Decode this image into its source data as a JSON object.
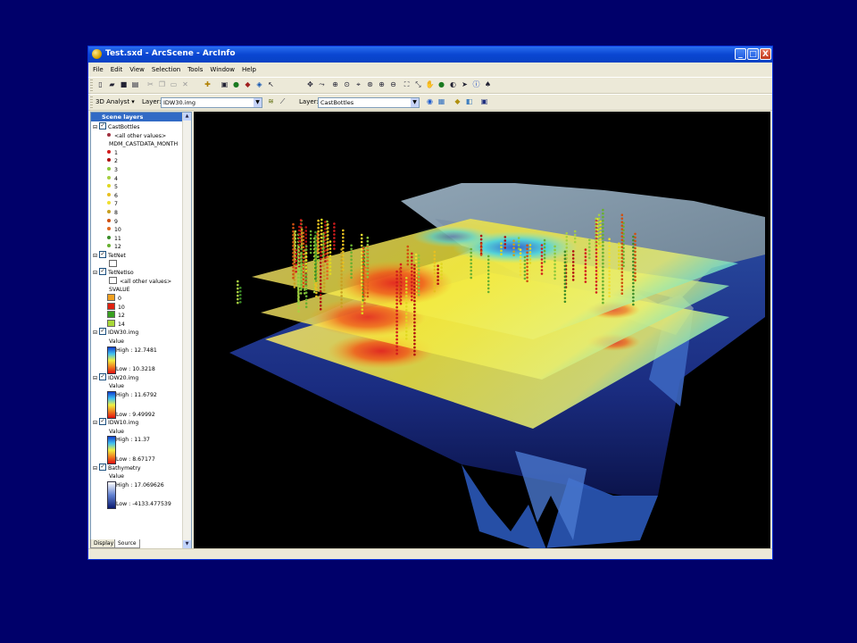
{
  "window": {
    "title": "Test.sxd - ArcScene - ArcInfo",
    "buttons": [
      "_",
      "□",
      "X"
    ]
  },
  "menu": [
    "File",
    "Edit",
    "View",
    "Selection",
    "Tools",
    "Window",
    "Help"
  ],
  "toolbar": {
    "analyst_label": "3D Analyst ▾",
    "layer_label_1": "Layer:",
    "layer_value_1": "IDW30.img",
    "layer_label_2": "Layer:",
    "layer_value_2": "CastBottles"
  },
  "toc": {
    "header": "Scene layers",
    "layers": [
      {
        "name": "CastBottles",
        "checked": true
      },
      {
        "name": "TetNet",
        "checked": true
      },
      {
        "name": "TetNetIso",
        "checked": true
      },
      {
        "name": "IDW30.img",
        "checked": true
      },
      {
        "name": "IDW20.img",
        "checked": true
      },
      {
        "name": "IDW10.img",
        "checked": true
      },
      {
        "name": "Bathymetry",
        "checked": true
      }
    ],
    "cast": {
      "other": "<all other values>",
      "field": "MDM_CASTDATA_MONTH",
      "values": [
        {
          "label": "1",
          "color": "#d21c1c"
        },
        {
          "label": "2",
          "color": "#b01010"
        },
        {
          "label": "3",
          "color": "#8cc83c"
        },
        {
          "label": "4",
          "color": "#a8d040"
        },
        {
          "label": "5",
          "color": "#e0d820"
        },
        {
          "label": "6",
          "color": "#e8c020"
        },
        {
          "label": "7",
          "color": "#f0e030"
        },
        {
          "label": "8",
          "color": "#c8a020"
        },
        {
          "label": "9",
          "color": "#d05010"
        },
        {
          "label": "10",
          "color": "#e06820"
        },
        {
          "label": "11",
          "color": "#3c8c28"
        },
        {
          "label": "12",
          "color": "#68b030"
        }
      ]
    },
    "iso": {
      "other": "<all other values>",
      "field": "SVALUE",
      "values": [
        {
          "label": "0",
          "color": "#f0a020"
        },
        {
          "label": "10",
          "color": "#e02010"
        },
        {
          "label": "12",
          "color": "#38a020"
        },
        {
          "label": "14",
          "color": "#a8d838"
        }
      ]
    },
    "idw30": {
      "value": "Value",
      "high": "High : 12.7481",
      "low": "Low : 10.3218"
    },
    "idw20": {
      "value": "Value",
      "high": "High : 11.6792",
      "low": "Low : 9.49992"
    },
    "idw10": {
      "value": "Value",
      "high": "High : 11.37",
      "low": "Low : 8.67177"
    },
    "bathy": {
      "value": "Value",
      "high": "High : 17.069626",
      "low": "Low : -4133.477539"
    },
    "tabs": [
      "Display",
      "Source"
    ]
  },
  "colors": {
    "background": "#00006a",
    "ramp_idw": "blue-cyan-yellow-red",
    "ramp_bathy": "white-to-navy"
  }
}
